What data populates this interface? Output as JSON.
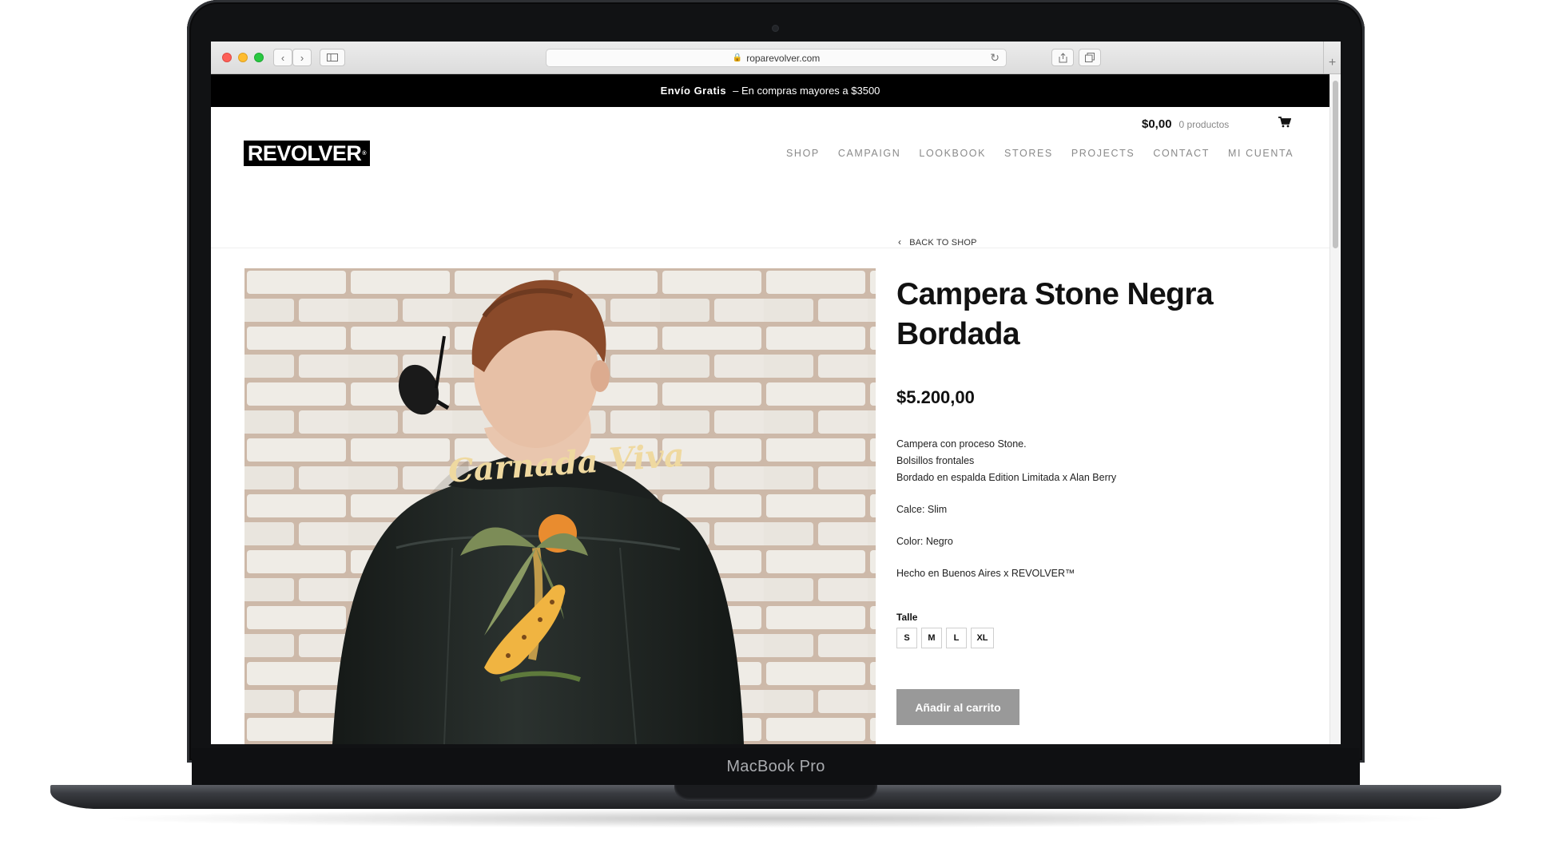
{
  "browser": {
    "url": "roparevolver.com"
  },
  "announcement": {
    "bold": "Envío Gratis",
    "text": "– En compras mayores a $3500"
  },
  "header": {
    "logo": "REVOLVER",
    "cart_total": "$0,00",
    "cart_count": "0 productos",
    "nav": [
      "SHOP",
      "CAMPAIGN",
      "LOOKBOOK",
      "STORES",
      "PROJECTS",
      "CONTACT",
      "MI CUENTA"
    ]
  },
  "product": {
    "back_link": "BACK TO SHOP",
    "title": "Campera Stone Negra Bordada",
    "price": "$5.200,00",
    "description": [
      "Campera con proceso Stone.",
      "Bolsillos frontales",
      "Bordado en espalda Edition Limitada x Alan Berry",
      "Calce: Slim",
      "Color: Negro",
      "Hecho en Buenos Aires x REVOLVER™"
    ],
    "size_label": "Talle",
    "sizes": [
      "S",
      "M",
      "L",
      "XL"
    ],
    "add_to_cart": "Añadir al carrito",
    "image_embroidery_text": "Carnada Viva"
  },
  "device": {
    "label": "MacBook Pro"
  }
}
